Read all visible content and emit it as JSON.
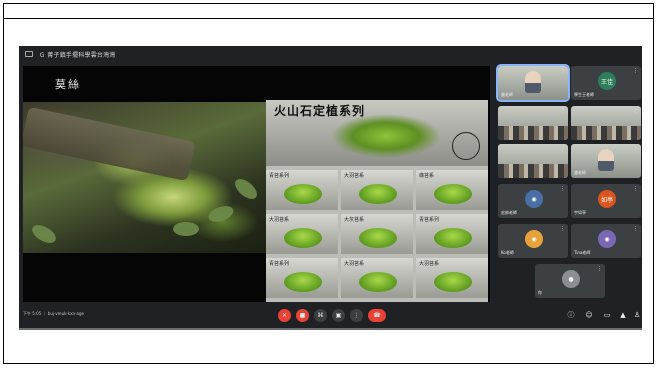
{
  "window": {
    "title": "Ｇ 菁子鎮手擺科學雲台灣灣"
  },
  "slide": {
    "left_title": "莫絲",
    "poster_title": "火山石定植系列",
    "cells": [
      {
        "label": "青苔系列"
      },
      {
        "label": "大羽苔系"
      },
      {
        "label": "綠苔系"
      },
      {
        "label": "大羽苔系"
      },
      {
        "label": "大灰苔系"
      },
      {
        "label": "青苔系列"
      },
      {
        "label": "青苔系列"
      },
      {
        "label": "大羽苔系"
      },
      {
        "label": "大羽苔系"
      }
    ]
  },
  "participants": [
    {
      "name": "盧老師",
      "kind": "video-face",
      "active": true
    },
    {
      "name": "學生王老師",
      "kind": "avatar",
      "initials": "王佳",
      "color": "#2e7d5b"
    },
    {
      "name": "",
      "kind": "video-room"
    },
    {
      "name": "",
      "kind": "video-room"
    },
    {
      "name": "",
      "kind": "video-room"
    },
    {
      "name": "盧老師",
      "kind": "video-face"
    },
    {
      "name": "宏帥老師",
      "kind": "avatar",
      "initials": "",
      "color": "#4a6fa5"
    },
    {
      "name": "宇如亭",
      "kind": "avatar",
      "initials": "如亭",
      "color": "#d9541e"
    },
    {
      "name": "Ko老師",
      "kind": "avatar",
      "initials": "",
      "color": "#e8a23a"
    },
    {
      "name": "Tina老師",
      "kind": "avatar",
      "initials": "",
      "color": "#7b68b5"
    },
    {
      "name": "你",
      "kind": "self"
    }
  ],
  "meeting_info": "下午 5:05 ｜ buj-vmuk-kxn-age",
  "controls": {
    "mic": "mic-off",
    "camera": "camera-off",
    "captions": "captions",
    "present": "present",
    "more": "more",
    "end": "end-call"
  },
  "colors": {
    "background": "#202124",
    "tile": "#3c4043",
    "end_call": "#ea4335",
    "active_outline": "#8ab4f8"
  }
}
